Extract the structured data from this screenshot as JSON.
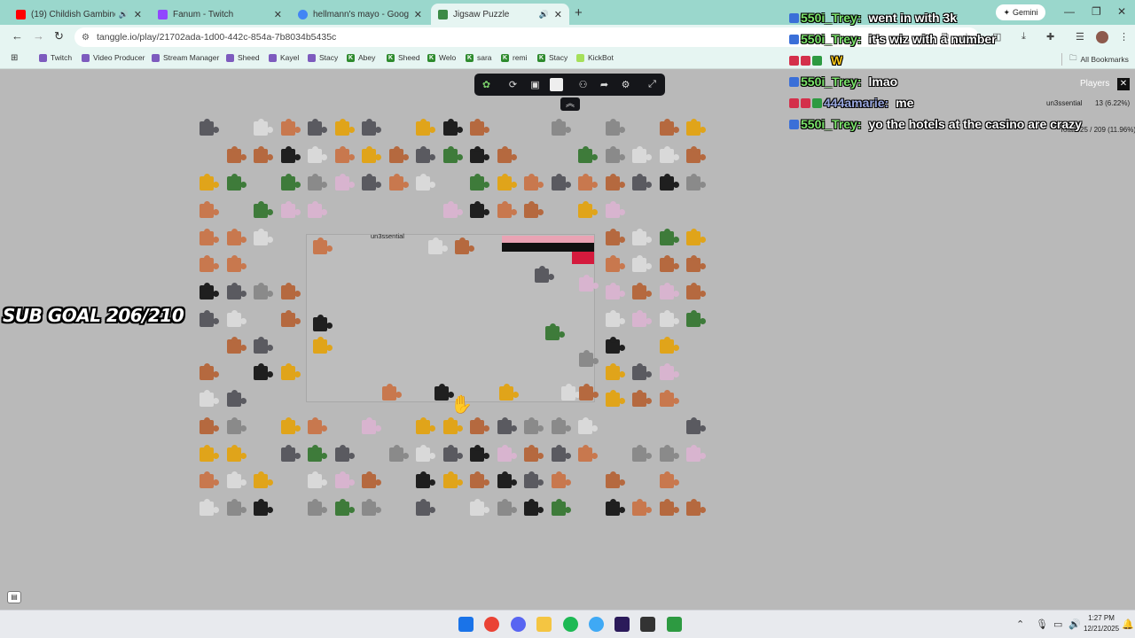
{
  "browser": {
    "tabs": [
      {
        "title": "(19) Childish Gambino - Sc",
        "favicon_color": "#ff0000",
        "active": false,
        "audio": true
      },
      {
        "title": "Fanum - Twitch",
        "favicon_color": "#9146ff",
        "active": false,
        "audio": false
      },
      {
        "title": "hellmann's mayo - Google Sea",
        "favicon_color": "#4285f4",
        "active": false,
        "audio": false
      },
      {
        "title": "Jigsaw Puzzle",
        "favicon_color": "#3c8a46",
        "active": true,
        "audio": true
      }
    ],
    "new_tab_label": "+",
    "url": "tanggle.io/play/21702ada-1d00-442c-854a-7b8034b5435c",
    "bookmarks": [
      {
        "label": "Twitch",
        "icon": "tw"
      },
      {
        "label": "Video Producer",
        "icon": "tw"
      },
      {
        "label": "Stream Manager",
        "icon": "tw"
      },
      {
        "label": "Sheed",
        "icon": "tw"
      },
      {
        "label": "Kayel",
        "icon": "tw"
      },
      {
        "label": "Stacy",
        "icon": "tw"
      },
      {
        "label": "Abey",
        "icon": "k"
      },
      {
        "label": "Sheed",
        "icon": "k"
      },
      {
        "label": "Welo",
        "icon": "k"
      },
      {
        "label": "sara",
        "icon": "k"
      },
      {
        "label": "remi",
        "icon": "k"
      },
      {
        "label": "Stacy",
        "icon": "k"
      },
      {
        "label": "KickBot",
        "icon": "kb"
      }
    ],
    "all_bookmarks": "All Bookmarks",
    "gemini_label": "Gemini"
  },
  "puzzle": {
    "board_owner": "un3ssential",
    "toolbar_icons": [
      "jigsaw-logo-icon",
      "rotate-icon",
      "image-preview-icon",
      "edge-pieces-icon",
      "players-icon",
      "share-icon",
      "settings-icon",
      "fullscreen-icon"
    ],
    "players_label": "Players",
    "players": [
      {
        "name": "un3ssential",
        "score": "13 (6.22%)"
      },
      {
        "name": "Total",
        "score": "25 / 209 (11.96%)"
      }
    ]
  },
  "overlay": {
    "sub_goal": "SUB GOAL 206/210"
  },
  "chat": [
    {
      "user": "550i_Trey",
      "text": "went in with 3k",
      "user_color": "#7be36b",
      "badges": [
        "#3a6fd8"
      ]
    },
    {
      "user": "550i_Trey",
      "text": "it's wiz with a number",
      "user_color": "#7be36b",
      "badges": [
        "#3a6fd8"
      ]
    },
    {
      "user": "",
      "text": "W",
      "user_color": "#b36bff",
      "badges": [
        "#d4304b",
        "#d4304b",
        "#2d9a41"
      ]
    },
    {
      "user": "550i_Trey",
      "text": "lmao",
      "user_color": "#7be36b",
      "badges": [
        "#3a6fd8"
      ]
    },
    {
      "user": "444amarie",
      "text": "me",
      "user_color": "#9aa8e0",
      "badges": [
        "#d4304b",
        "#d4304b",
        "#2d9a41"
      ]
    },
    {
      "user": "550i_Trey",
      "text": "yo the hotels at the casino are crazy",
      "user_color": "#7be36b",
      "badges": [
        "#3a6fd8"
      ]
    }
  ],
  "taskbar": {
    "time": "1:27 PM",
    "date": "12/21/2025",
    "apps": [
      "windows-start-icon",
      "chrome-icon",
      "discord-icon",
      "file-explorer-icon",
      "spotify-icon",
      "copilot-icon",
      "premiere-icon",
      "stream-app-icon",
      "app-icon"
    ]
  }
}
